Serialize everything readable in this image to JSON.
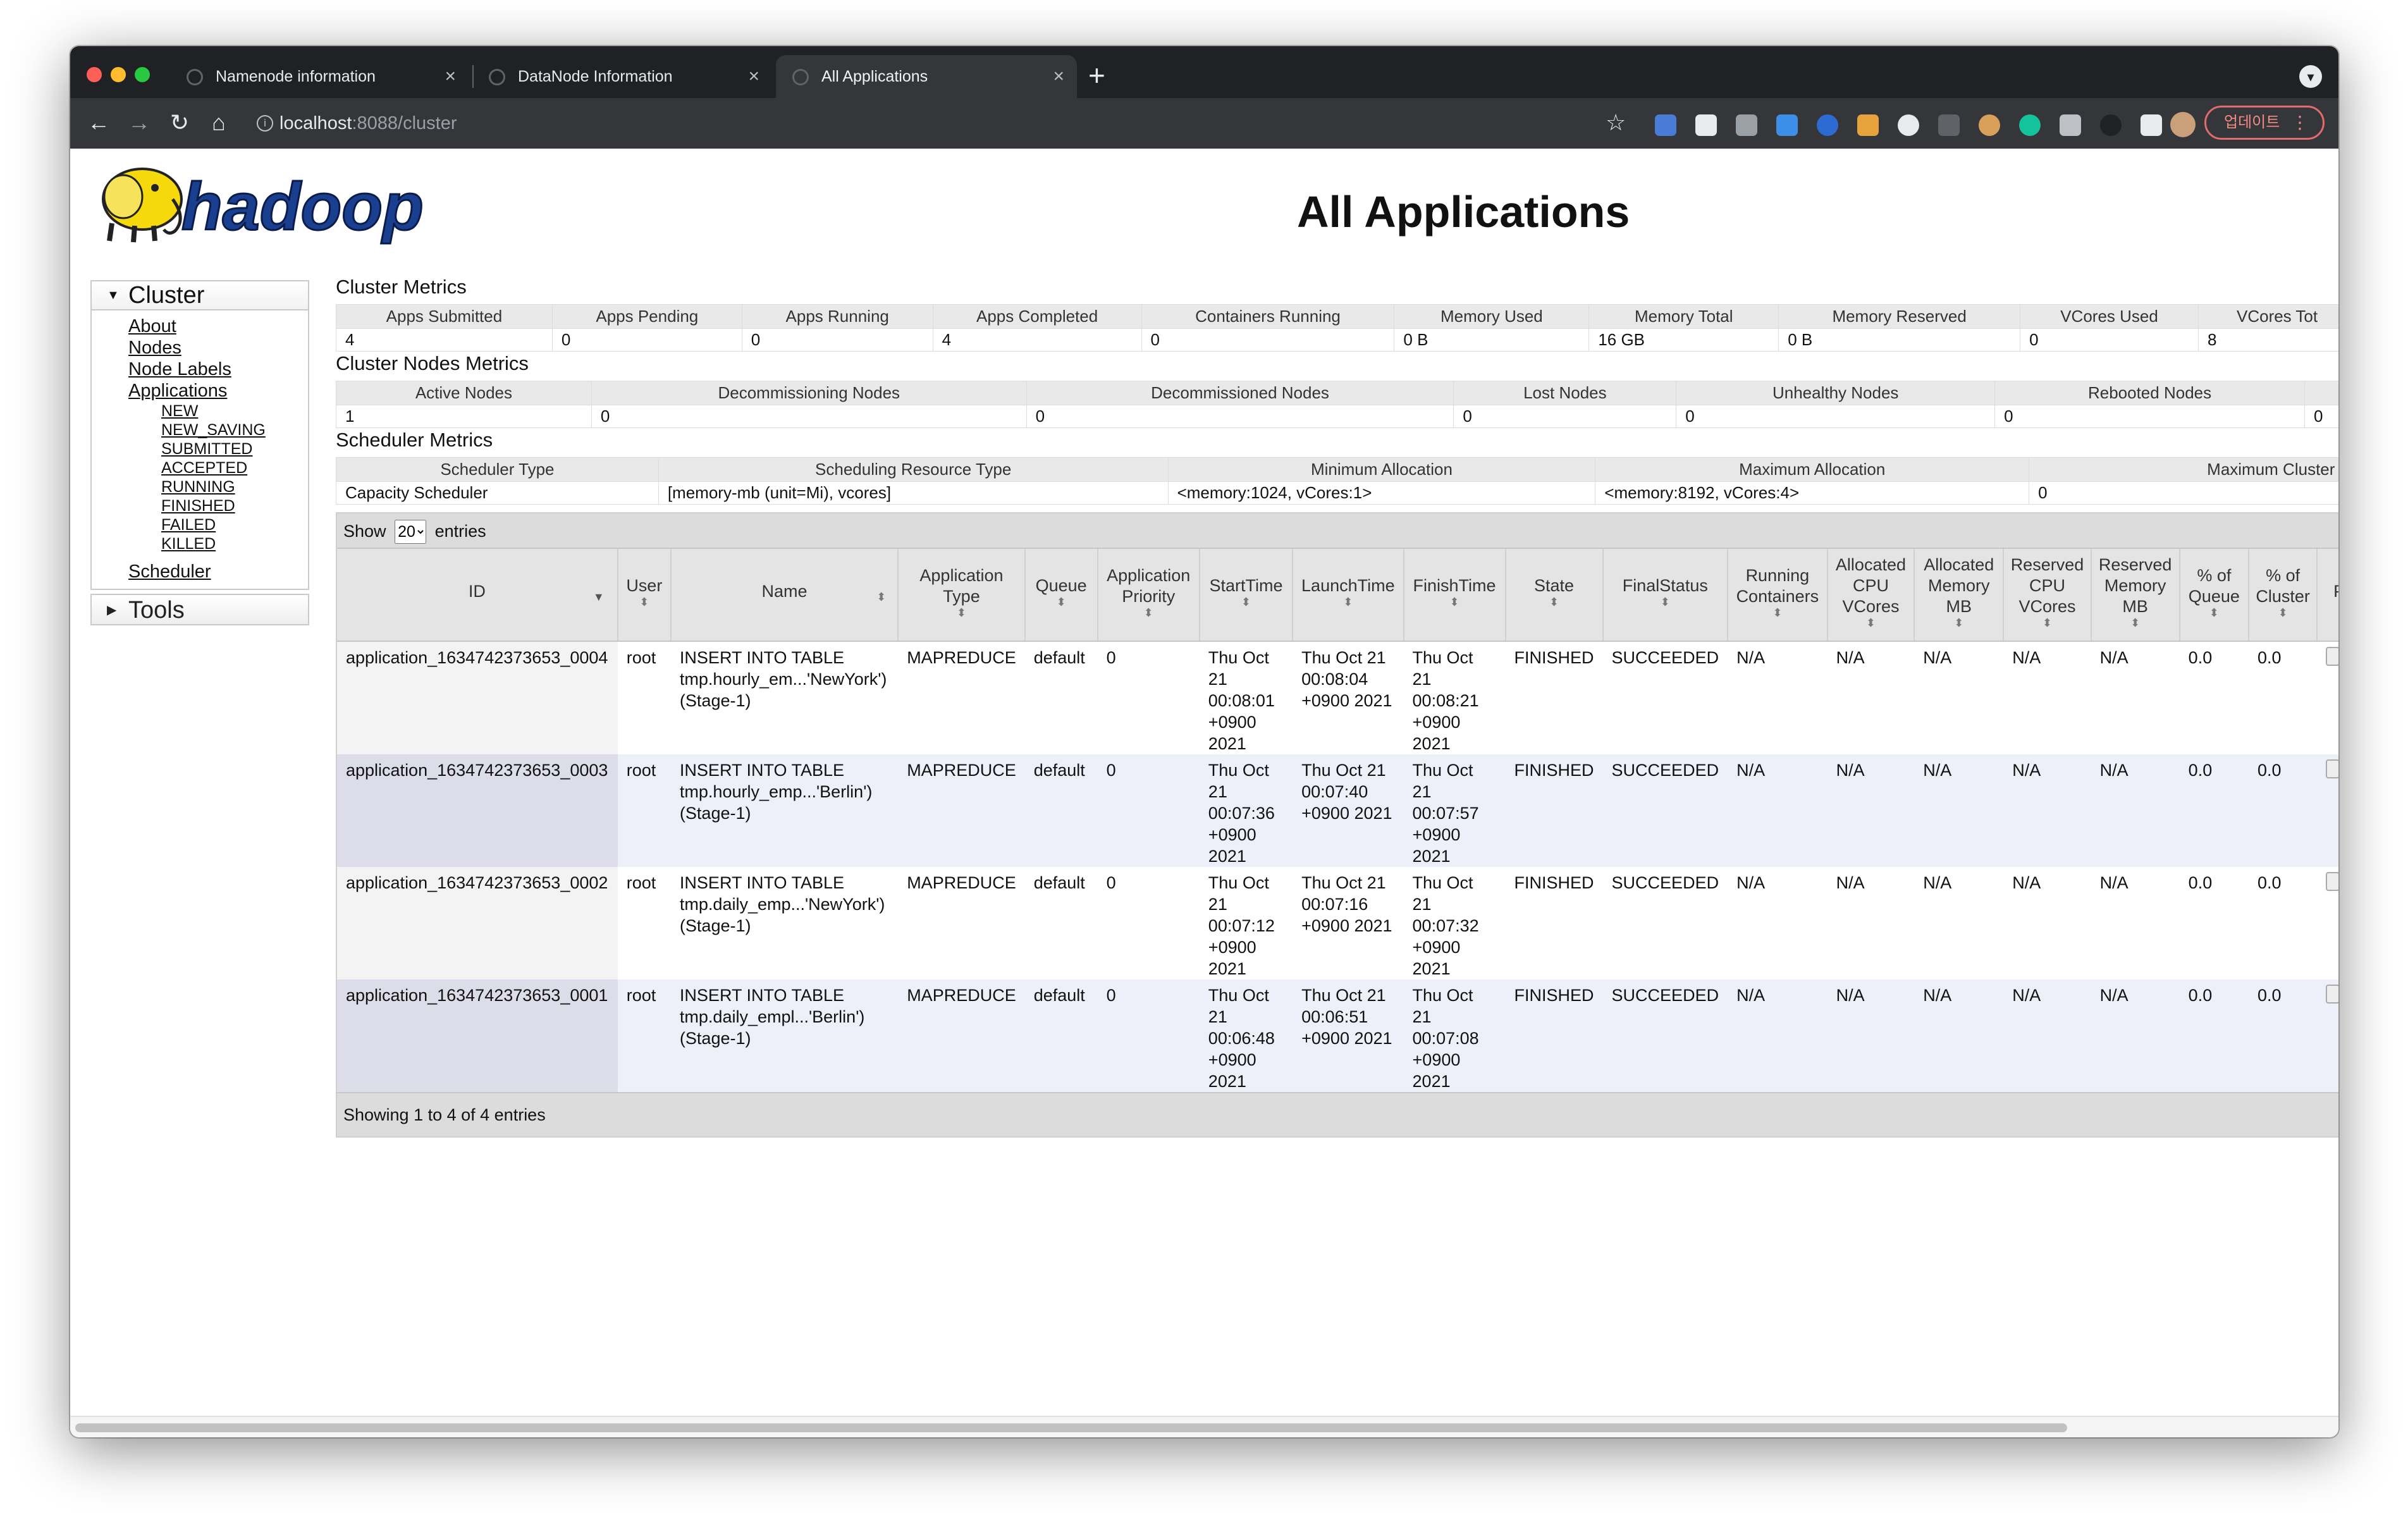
{
  "browser": {
    "tabs": [
      {
        "label": "Namenode information"
      },
      {
        "label": "DataNode Information"
      },
      {
        "label": "All Applications"
      }
    ],
    "new_tab": "+",
    "url_host": "localhost",
    "url_path": ":8088/cluster",
    "update_label": "업데이트"
  },
  "page": {
    "title": "All Applications",
    "logo_text": "hadoop"
  },
  "sidebar": {
    "cluster": "Cluster",
    "links": [
      {
        "label": "About"
      },
      {
        "label": "Nodes"
      },
      {
        "label": "Node Labels"
      },
      {
        "label": "Applications"
      }
    ],
    "app_states": [
      {
        "label": "NEW"
      },
      {
        "label": "NEW_SAVING"
      },
      {
        "label": "SUBMITTED"
      },
      {
        "label": "ACCEPTED"
      },
      {
        "label": "RUNNING"
      },
      {
        "label": "FINISHED"
      },
      {
        "label": "FAILED"
      },
      {
        "label": "KILLED"
      }
    ],
    "scheduler": "Scheduler",
    "tools": "Tools"
  },
  "cluster_metrics": {
    "title": "Cluster Metrics",
    "headers": [
      "Apps Submitted",
      "Apps Pending",
      "Apps Running",
      "Apps Completed",
      "Containers Running",
      "Memory Used",
      "Memory Total",
      "Memory Reserved",
      "VCores Used",
      "VCores Tot"
    ],
    "values": [
      "4",
      "0",
      "0",
      "4",
      "0",
      "0 B",
      "16 GB",
      "0 B",
      "0",
      "8"
    ]
  },
  "nodes_metrics": {
    "title": "Cluster Nodes Metrics",
    "headers": [
      "Active Nodes",
      "Decommissioning Nodes",
      "Decommissioned Nodes",
      "Lost Nodes",
      "Unhealthy Nodes",
      "Rebooted Nodes",
      ""
    ],
    "values": [
      "1",
      "0",
      "0",
      "0",
      "0",
      "0",
      "0"
    ]
  },
  "scheduler_metrics": {
    "title": "Scheduler Metrics",
    "headers": [
      "Scheduler Type",
      "Scheduling Resource Type",
      "Minimum Allocation",
      "Maximum Allocation",
      "Maximum Cluster Ap"
    ],
    "values": [
      "Capacity Scheduler",
      "[memory-mb (unit=Mi), vcores]",
      "<memory:1024, vCores:1>",
      "<memory:8192, vCores:4>",
      "0"
    ]
  },
  "apps": {
    "show_label": "Show",
    "entries_label": "entries",
    "page_size": "20",
    "headers": [
      {
        "label": "ID"
      },
      {
        "label": "User"
      },
      {
        "label": "Name"
      },
      {
        "label": "Application Type"
      },
      {
        "label": "Queue"
      },
      {
        "label": "Application Priority"
      },
      {
        "label": "StartTime"
      },
      {
        "label": "LaunchTime"
      },
      {
        "label": "FinishTime"
      },
      {
        "label": "State"
      },
      {
        "label": "FinalStatus"
      },
      {
        "label": "Running Containers"
      },
      {
        "label": "Allocated CPU VCores"
      },
      {
        "label": "Allocated Memory MB"
      },
      {
        "label": "Reserved CPU VCores"
      },
      {
        "label": "Reserved Memory MB"
      },
      {
        "label": "% of Queue"
      },
      {
        "label": "% of Cluster"
      },
      {
        "label": "P"
      }
    ],
    "rows": [
      {
        "id": "application_1634742373653_0004",
        "user": "root",
        "name": "INSERT INTO TABLE tmp.hourly_em...'NewYork')(Stage-1)",
        "type": "MAPREDUCE",
        "queue": "default",
        "priority": "0",
        "start": "Thu Oct 21 00:08:01 +0900 2021",
        "launch": "Thu Oct 21 00:08:04 +0900 2021",
        "finish": "Thu Oct 21 00:08:21 +0900 2021",
        "state": "FINISHED",
        "final": "SUCCEEDED",
        "running": "N/A",
        "alloc_cpu": "N/A",
        "alloc_mem": "N/A",
        "res_cpu": "N/A",
        "res_mem": "N/A",
        "pct_queue": "0.0",
        "pct_cluster": "0.0"
      },
      {
        "id": "application_1634742373653_0003",
        "user": "root",
        "name": "INSERT INTO TABLE tmp.hourly_emp...'Berlin')(Stage-1)",
        "type": "MAPREDUCE",
        "queue": "default",
        "priority": "0",
        "start": "Thu Oct 21 00:07:36 +0900 2021",
        "launch": "Thu Oct 21 00:07:40 +0900 2021",
        "finish": "Thu Oct 21 00:07:57 +0900 2021",
        "state": "FINISHED",
        "final": "SUCCEEDED",
        "running": "N/A",
        "alloc_cpu": "N/A",
        "alloc_mem": "N/A",
        "res_cpu": "N/A",
        "res_mem": "N/A",
        "pct_queue": "0.0",
        "pct_cluster": "0.0"
      },
      {
        "id": "application_1634742373653_0002",
        "user": "root",
        "name": "INSERT INTO TABLE tmp.daily_emp...'NewYork')(Stage-1)",
        "type": "MAPREDUCE",
        "queue": "default",
        "priority": "0",
        "start": "Thu Oct 21 00:07:12 +0900 2021",
        "launch": "Thu Oct 21 00:07:16 +0900 2021",
        "finish": "Thu Oct 21 00:07:32 +0900 2021",
        "state": "FINISHED",
        "final": "SUCCEEDED",
        "running": "N/A",
        "alloc_cpu": "N/A",
        "alloc_mem": "N/A",
        "res_cpu": "N/A",
        "res_mem": "N/A",
        "pct_queue": "0.0",
        "pct_cluster": "0.0"
      },
      {
        "id": "application_1634742373653_0001",
        "user": "root",
        "name": "INSERT INTO TABLE tmp.daily_empl...'Berlin')(Stage-1)",
        "type": "MAPREDUCE",
        "queue": "default",
        "priority": "0",
        "start": "Thu Oct 21 00:06:48 +0900 2021",
        "launch": "Thu Oct 21 00:06:51 +0900 2021",
        "finish": "Thu Oct 21 00:07:08 +0900 2021",
        "state": "FINISHED",
        "final": "SUCCEEDED",
        "running": "N/A",
        "alloc_cpu": "N/A",
        "alloc_mem": "N/A",
        "res_cpu": "N/A",
        "res_mem": "N/A",
        "pct_queue": "0.0",
        "pct_cluster": "0.0"
      }
    ],
    "footer": "Showing 1 to 4 of 4 entries"
  },
  "colors": {
    "tab_bar": "#202124",
    "toolbar": "#35363a",
    "logo_yellow": "#f5d90a",
    "logo_blue": "#1b3f8f"
  }
}
